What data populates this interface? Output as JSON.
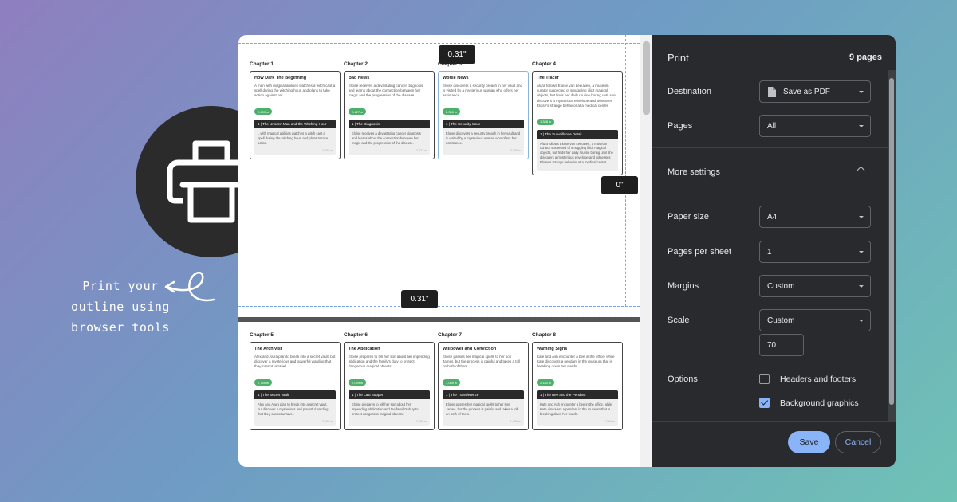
{
  "promo": {
    "lines": [
      "Print your",
      "outline using",
      "browser tools"
    ],
    "icon": "printer-icon"
  },
  "preview": {
    "margin_top": "0.31\"",
    "margin_right": "0\"",
    "margin_bottom": "0.31\"",
    "page1": [
      {
        "chapter": "Chapter 1",
        "title": "How Dark The Beginning",
        "text": "A man with magical abilities watches a witch cast a spell during the witching hour, and plans to take action against her.",
        "words": "2,459 w",
        "scene": "1 | The Unseen Man and the Witching Hour",
        "scene_text": "...with magical abilities watches a witch cast a spell during the witching hour, and plans to take action.",
        "scene_words": "2,459 w"
      },
      {
        "chapter": "Chapter 2",
        "title": "Bad News",
        "text": "Eloise receives a devastating cancer diagnosis and learns about the connection between her magic and the progression of the disease.",
        "words": "2,427 w",
        "scene": "1 | The Diagnosis",
        "scene_text": "Eloise receives a devastating cancer diagnosis and learns about the connection between her magic and the progression of the disease.",
        "scene_words": "2,427 w"
      },
      {
        "chapter": "Chapter 3",
        "title": "Worse News",
        "text": "Eloise discovers a security breach in her vault and is visited by a mysterious woman who offers her assistance.",
        "words": "2,350 w",
        "scene": "1 | The Security Issue",
        "scene_text": "Eloise discovers a security breach in her vault and is visited by a mysterious woman who offers her assistance.",
        "scene_words": "2,350 w"
      },
      {
        "chapter": "Chapter 4",
        "title": "The Tracer",
        "text": "Alura follows Eloise van Leeuwen, a museum curator suspected of smuggling illicit magical objects, but finds her daily routine boring until she discovers a mysterious envelope and witnesses Eloise's strange behavior at a medical center.",
        "words": "1,338 w",
        "scene": "1 | The Surveillance Detail",
        "scene_text": "Alura follows Eloise van Leeuwen, a museum curator suspected of smuggling illicit magical objects, but finds her daily routine boring until she discovers a mysterious envelope and witnesses Eloise's strange behavior at a medical center.",
        "scene_words": ""
      }
    ],
    "page2": [
      {
        "chapter": "Chapter 5",
        "title": "The Archivist",
        "text": "Alex and Alura plan to break into a secret vault, but discover a mysterious and powerful warding that they cannot unravel.",
        "words": "2,765 w",
        "scene": "1 | The Secret Vault",
        "scene_text": "Alex and Alura plan to break into a secret vault, but discover a mysterious and powerful warding that they cannot unravel.",
        "scene_words": "2,765 w"
      },
      {
        "chapter": "Chapter 6",
        "title": "The Abdication",
        "text": "Eloise prepares to tell her son about her impending abdication and the family's duty to protect dangerous magical objects.",
        "words": "2,099 w",
        "scene": "1 | The Last Supper",
        "scene_text": "Eloise prepares to tell her son about her impending abdication and the family's duty to protect dangerous magical objects.",
        "scene_words": "2,099 w"
      },
      {
        "chapter": "Chapter 7",
        "title": "Willpower and Conviction",
        "text": "Eloise passes her magical spells to her son James, but the process is painful and takes a toll on both of them.",
        "words": "1,089 w",
        "scene": "1 | The Transference",
        "scene_text": "Eloise passes her magical spells to her son James, but the process is painful and takes a toll on both of them.",
        "scene_words": "1,089 w"
      },
      {
        "chapter": "Chapter 8",
        "title": "Warning Signs",
        "text": "Kate and Ash encounter a bee in the office, while Kate discovers a pendant in the museum that is breaking down her wards.",
        "words": "2,184 w",
        "scene": "1 | The Bee and the Pendant",
        "scene_text": "Kate and Ash encounter a bee in the office, while Kate discovers a pendant in the museum that is breaking down her wards.",
        "scene_words": "2,184 w"
      }
    ]
  },
  "panel": {
    "title": "Print",
    "page_count": "9 pages",
    "destination_label": "Destination",
    "destination_value": "Save as PDF",
    "pages_label": "Pages",
    "pages_value": "All",
    "more_settings": "More settings",
    "paper_size_label": "Paper size",
    "paper_size_value": "A4",
    "pps_label": "Pages per sheet",
    "pps_value": "1",
    "margins_label": "Margins",
    "margins_value": "Custom",
    "scale_label": "Scale",
    "scale_value": "Custom",
    "scale_number": "70",
    "options_label": "Options",
    "headers_footers": "Headers and footers",
    "headers_footers_checked": false,
    "background_graphics": "Background graphics",
    "background_graphics_checked": true,
    "save": "Save",
    "cancel": "Cancel"
  }
}
